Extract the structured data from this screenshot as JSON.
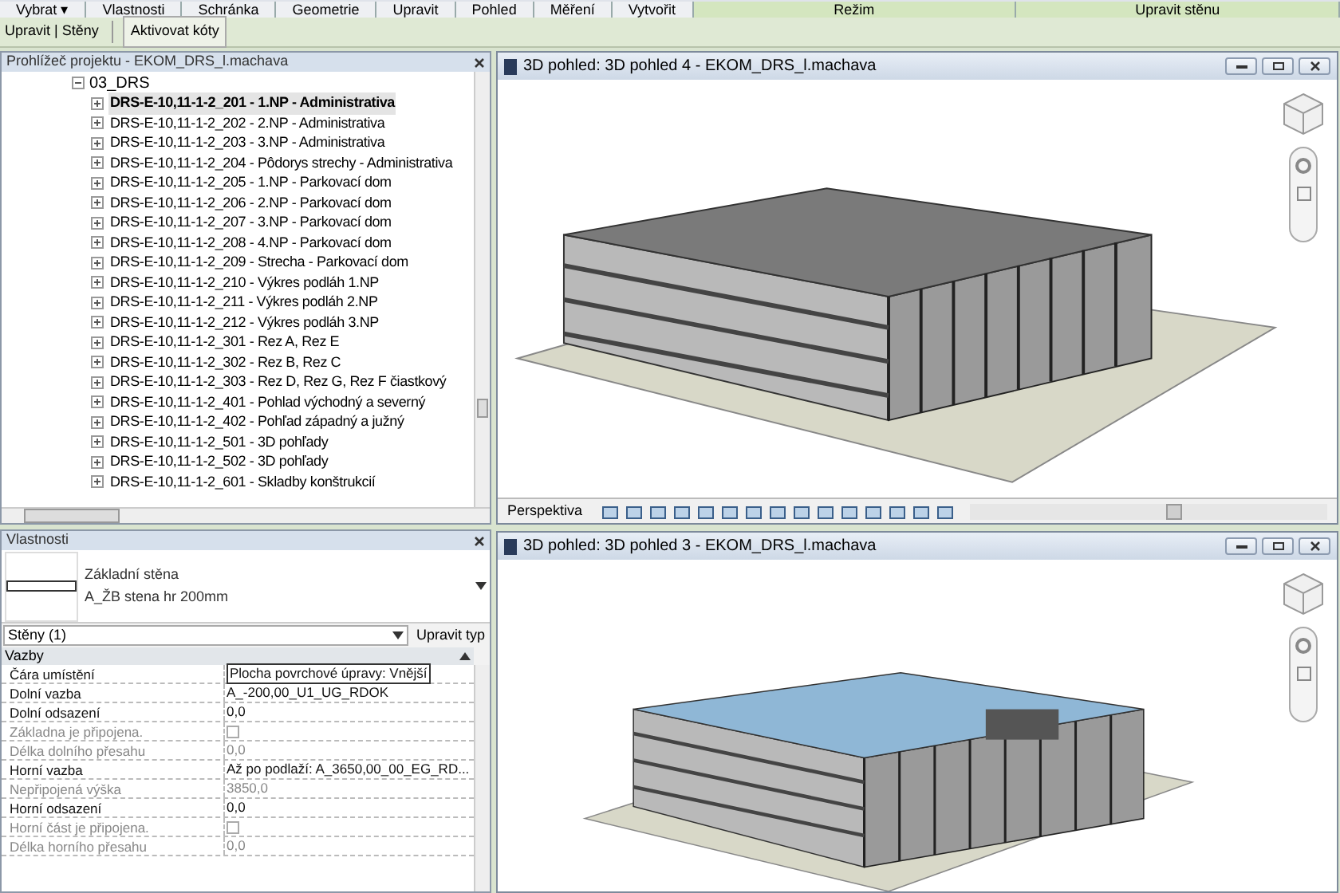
{
  "ribbon_panels": [
    "Vybrat ▾",
    "Vlastnosti",
    "Schránka",
    "Geometrie",
    "Upravit",
    "Pohled",
    "Měření",
    "Vytvořit",
    "Režim",
    "Upravit stěnu"
  ],
  "context_bar": {
    "label": "Upravit | Stěny",
    "button": "Aktivovat kóty"
  },
  "project_browser": {
    "title": "Prohlížeč projektu - EKOM_DRS_l.machava",
    "folder": {
      "label": "03_DRS",
      "expanded": true,
      "children": [
        {
          "label": "DRS-E-10,11-1-2_201 - 1.NP - Administrativa",
          "selected": true
        },
        {
          "label": "DRS-E-10,11-1-2_202 - 2.NP - Administrativa",
          "selected": false
        },
        {
          "label": "DRS-E-10,11-1-2_203 - 3.NP - Administrativa",
          "selected": false
        },
        {
          "label": "DRS-E-10,11-1-2_204 - Pôdorys strechy - Administrativa",
          "selected": false
        },
        {
          "label": "DRS-E-10,11-1-2_205 - 1.NP - Parkovací dom",
          "selected": false
        },
        {
          "label": "DRS-E-10,11-1-2_206 - 2.NP - Parkovací dom",
          "selected": false
        },
        {
          "label": "DRS-E-10,11-1-2_207 - 3.NP - Parkovací dom",
          "selected": false
        },
        {
          "label": "DRS-E-10,11-1-2_208 - 4.NP - Parkovací dom",
          "selected": false
        },
        {
          "label": "DRS-E-10,11-1-2_209 - Strecha - Parkovací dom",
          "selected": false
        },
        {
          "label": "DRS-E-10,11-1-2_210 - Výkres podláh 1.NP",
          "selected": false
        },
        {
          "label": "DRS-E-10,11-1-2_211 - Výkres podláh 2.NP",
          "selected": false
        },
        {
          "label": "DRS-E-10,11-1-2_212 - Výkres podláh 3.NP",
          "selected": false
        },
        {
          "label": "DRS-E-10,11-1-2_301 - Rez A, Rez E",
          "selected": false
        },
        {
          "label": "DRS-E-10,11-1-2_302 - Rez B, Rez C",
          "selected": false
        },
        {
          "label": "DRS-E-10,11-1-2_303 - Rez D, Rez G, Rez F čiastkový",
          "selected": false
        },
        {
          "label": "DRS-E-10,11-1-2_401 - Pohlad východný a severný",
          "selected": false
        },
        {
          "label": "DRS-E-10,11-1-2_402 - Pohľad západný a južný",
          "selected": false
        },
        {
          "label": "DRS-E-10,11-1-2_501 - 3D pohľady",
          "selected": false
        },
        {
          "label": "DRS-E-10,11-1-2_502 - 3D pohľady",
          "selected": false
        },
        {
          "label": "DRS-E-10,11-1-2_601 - Skladby konštrukcií",
          "selected": false
        }
      ]
    }
  },
  "properties": {
    "title": "Vlastnosti",
    "family": "Základní stěna",
    "type": "A_ŽB stena hr 200mm",
    "filter": "Stěny (1)",
    "edit_type": "Upravit typ",
    "group": "Vazby",
    "rows": [
      {
        "name": "Čára umístění",
        "kind": "text",
        "value": "Plocha povrchové úpravy: Vnější",
        "disabled": false
      },
      {
        "name": "Dolní vazba",
        "kind": "text",
        "value": "A_-200,00_U1_UG_RDOK",
        "disabled": false
      },
      {
        "name": "Dolní odsazení",
        "kind": "text",
        "value": "0,0",
        "disabled": false
      },
      {
        "name": "Základna je připojena.",
        "kind": "checkbox",
        "checked": false,
        "disabled": true
      },
      {
        "name": "Délka dolního přesahu",
        "kind": "text",
        "value": "0,0",
        "disabled": true
      },
      {
        "name": "Horní vazba",
        "kind": "text",
        "value": "Až po podlaží: A_3650,00_00_EG_RD...",
        "disabled": false
      },
      {
        "name": "Nepřipojená výška",
        "kind": "text",
        "value": "3850,0",
        "disabled": true
      },
      {
        "name": "Horní odsazení",
        "kind": "text",
        "value": "0,0",
        "disabled": false
      },
      {
        "name": "Horní část je připojena.",
        "kind": "checkbox",
        "checked": false,
        "disabled": true
      },
      {
        "name": "Délka horního přesahu",
        "kind": "text",
        "value": "0,0",
        "disabled": true
      }
    ]
  },
  "views": [
    {
      "title": "3D pohled: 3D pohled 4 - EKOM_DRS_l.machava",
      "view_bar": "Perspektiva"
    },
    {
      "title": "3D pohled: 3D pohled 3 - EKOM_DRS_l.machava"
    }
  ]
}
